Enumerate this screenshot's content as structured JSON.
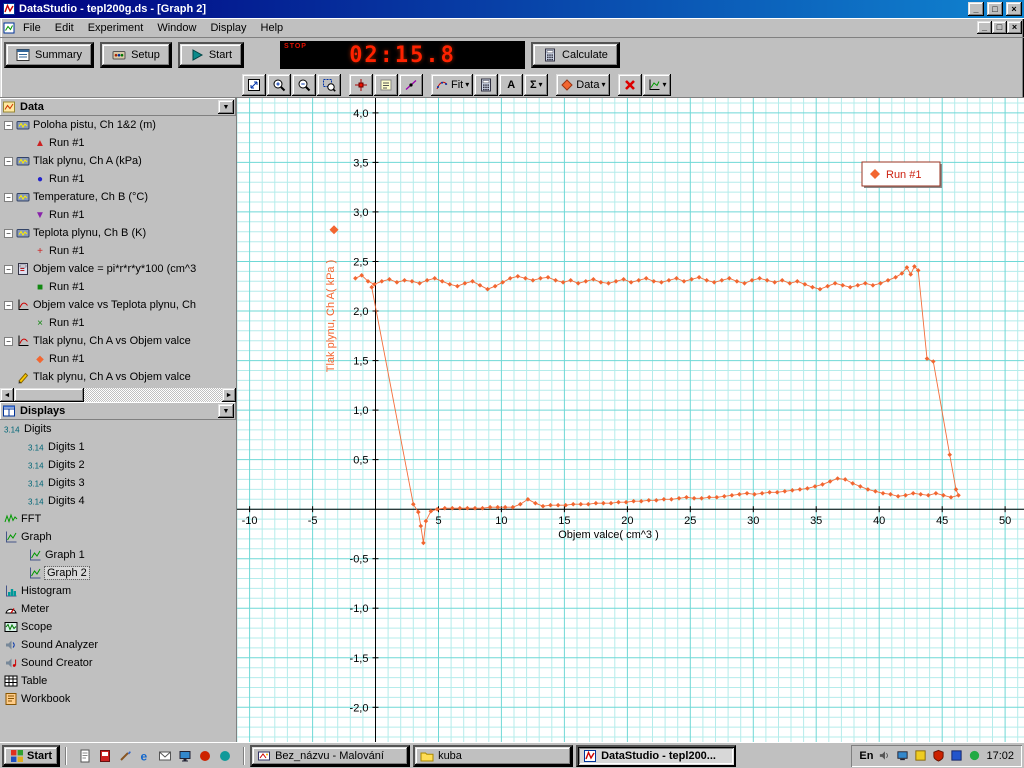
{
  "colors": {
    "grid_minor": "#b5eceb",
    "grid_major": "#6fd8d6",
    "series_orange": "#f26630",
    "legend_text": "#cc2211",
    "chrome": "#c0c0c0"
  },
  "window": {
    "title": "DataStudio - tepl200g.ds - [Graph 2]",
    "menus": [
      "File",
      "Edit",
      "Experiment",
      "Window",
      "Display",
      "Help"
    ]
  },
  "toolbar": {
    "summary_label": "Summary",
    "setup_label": "Setup",
    "start_label": "Start",
    "timer_stop": "STOP",
    "timer_value": "02:15.8",
    "calculate_label": "Calculate"
  },
  "graph_toolbar": {
    "buttons": [
      {
        "name": "scale-to-fit-button",
        "icon": "scale_fit"
      },
      {
        "name": "zoom-in-button",
        "icon": "zoom_in"
      },
      {
        "name": "zoom-out-button",
        "icon": "zoom_out"
      },
      {
        "name": "zoom-select-button",
        "icon": "zoom_sel",
        "gap": true
      },
      {
        "name": "smart-tool-button",
        "icon": "smart"
      },
      {
        "name": "note-tool-button",
        "icon": "note"
      },
      {
        "name": "slope-tool-button",
        "icon": "slope",
        "gap": true
      },
      {
        "name": "fit-menu-button",
        "icon": "fit_line",
        "label": "Fit",
        "dropdown": true
      },
      {
        "name": "calculator-tool-button",
        "icon": "calc"
      },
      {
        "name": "text-tool-button",
        "label": "A",
        "bold": true
      },
      {
        "name": "statistics-menu-button",
        "label": "Σ",
        "bold": true,
        "dropdown": true,
        "gap": true
      },
      {
        "name": "data-menu-button",
        "icon": "data_diamond",
        "label": "Data",
        "dropdown": true,
        "gap": true
      },
      {
        "name": "delete-button",
        "icon": "delete_x"
      },
      {
        "name": "graph-settings-button",
        "icon": "graph_settings",
        "dropdown": true
      }
    ]
  },
  "data_panel": {
    "title": "Data",
    "items": [
      {
        "label": "Poloha pistu, Ch 1&2 (m)",
        "icon": "sensor",
        "expand": true,
        "runs": [
          {
            "label": "Run #1",
            "marker": "triangle-up",
            "color": "#cc2222"
          }
        ]
      },
      {
        "label": "Tlak plynu, Ch A (kPa)",
        "icon": "sensor",
        "expand": true,
        "runs": [
          {
            "label": "Run #1",
            "marker": "circle",
            "color": "#2222cc"
          }
        ]
      },
      {
        "label": "Temperature, Ch B (°C)",
        "icon": "sensor",
        "expand": true,
        "runs": [
          {
            "label": "Run #1",
            "marker": "triangle-down",
            "color": "#8822aa"
          }
        ]
      },
      {
        "label": "Teplota plynu, Ch B (K)",
        "icon": "sensor",
        "expand": true,
        "runs": [
          {
            "label": "Run #1",
            "marker": "plus",
            "color": "#cc2222"
          }
        ]
      },
      {
        "label": "Objem valce = pi*r*r*y*100 (cm^3",
        "icon": "calcdata",
        "expand": true,
        "runs": [
          {
            "label": "Run #1",
            "marker": "square",
            "color": "#118811"
          }
        ]
      },
      {
        "label": "Objem valce vs Teplota plynu, Ch",
        "icon": "xy",
        "expand": true,
        "runs": [
          {
            "label": "Run #1",
            "marker": "x",
            "color": "#118811"
          }
        ]
      },
      {
        "label": "Tlak plynu, Ch A vs Objem valce",
        "icon": "xy",
        "expand": true,
        "runs": [
          {
            "label": "Run #1",
            "marker": "diamond",
            "color": "#f26630"
          }
        ]
      },
      {
        "label": "Tlak plynu, Ch A vs Objem valce",
        "icon": "pen",
        "expand": false,
        "runs": []
      }
    ]
  },
  "displays_panel": {
    "title": "Displays",
    "items": [
      {
        "label": "Digits",
        "icon": "digits",
        "children": [
          "Digits 1",
          "Digits 2",
          "Digits 3",
          "Digits 4"
        ]
      },
      {
        "label": "FFT",
        "icon": "fft",
        "children": []
      },
      {
        "label": "Graph",
        "icon": "graphd",
        "children": [
          "Graph 1",
          "Graph 2"
        ],
        "selected_child": "Graph 2"
      },
      {
        "label": "Histogram",
        "icon": "histogram",
        "children": []
      },
      {
        "label": "Meter",
        "icon": "meter",
        "children": []
      },
      {
        "label": "Scope",
        "icon": "scope",
        "children": []
      },
      {
        "label": "Sound Analyzer",
        "icon": "sound_an",
        "children": []
      },
      {
        "label": "Sound Creator",
        "icon": "sound_cr",
        "children": []
      },
      {
        "label": "Table",
        "icon": "table",
        "children": []
      },
      {
        "label": "Workbook",
        "icon": "workbook",
        "children": []
      }
    ]
  },
  "chart_data": {
    "type": "scatter",
    "title": "",
    "xlabel": "Objem valce( cm^3 )",
    "ylabel": "Tlak plynu, Ch A( kPa )",
    "xlim": [
      -11,
      51.5
    ],
    "ylim": [
      -2.35,
      4.15
    ],
    "x_ticks": [
      -10,
      -5,
      5,
      10,
      15,
      20,
      25,
      30,
      35,
      40,
      45,
      50
    ],
    "y_ticks": [
      4.0,
      3.5,
      3.0,
      2.5,
      2.0,
      1.5,
      1.0,
      0.5,
      -0.5,
      -1.0,
      -1.5,
      -2.0
    ],
    "grid": true,
    "legend": {
      "label": "Run #1",
      "position": "top-right"
    },
    "series": [
      {
        "name": "Run #1",
        "color": "#f26630",
        "marker": "diamond",
        "points": [
          [
            -1.6,
            2.33
          ],
          [
            -1.1,
            2.36
          ],
          [
            -0.6,
            2.3
          ],
          [
            -0.1,
            2.27
          ],
          [
            0.5,
            2.3
          ],
          [
            1.1,
            2.32
          ],
          [
            1.7,
            2.29
          ],
          [
            2.3,
            2.31
          ],
          [
            2.9,
            2.3
          ],
          [
            3.5,
            2.28
          ],
          [
            4.1,
            2.31
          ],
          [
            4.7,
            2.33
          ],
          [
            5.3,
            2.3
          ],
          [
            5.9,
            2.27
          ],
          [
            6.5,
            2.25
          ],
          [
            7.1,
            2.28
          ],
          [
            7.7,
            2.3
          ],
          [
            8.3,
            2.26
          ],
          [
            8.9,
            2.22
          ],
          [
            9.5,
            2.25
          ],
          [
            10.1,
            2.29
          ],
          [
            10.7,
            2.33
          ],
          [
            11.3,
            2.35
          ],
          [
            11.9,
            2.33
          ],
          [
            12.5,
            2.31
          ],
          [
            13.1,
            2.33
          ],
          [
            13.7,
            2.34
          ],
          [
            14.3,
            2.31
          ],
          [
            14.9,
            2.29
          ],
          [
            15.5,
            2.31
          ],
          [
            16.1,
            2.28
          ],
          [
            16.7,
            2.3
          ],
          [
            17.3,
            2.32
          ],
          [
            17.9,
            2.29
          ],
          [
            18.5,
            2.28
          ],
          [
            19.1,
            2.3
          ],
          [
            19.7,
            2.32
          ],
          [
            20.3,
            2.29
          ],
          [
            20.9,
            2.31
          ],
          [
            21.5,
            2.33
          ],
          [
            22.1,
            2.3
          ],
          [
            22.7,
            2.29
          ],
          [
            23.3,
            2.31
          ],
          [
            23.9,
            2.33
          ],
          [
            24.5,
            2.3
          ],
          [
            25.1,
            2.32
          ],
          [
            25.7,
            2.34
          ],
          [
            26.3,
            2.31
          ],
          [
            26.9,
            2.29
          ],
          [
            27.5,
            2.31
          ],
          [
            28.1,
            2.33
          ],
          [
            28.7,
            2.3
          ],
          [
            29.3,
            2.28
          ],
          [
            29.9,
            2.31
          ],
          [
            30.5,
            2.33
          ],
          [
            31.1,
            2.31
          ],
          [
            31.7,
            2.29
          ],
          [
            32.3,
            2.31
          ],
          [
            32.9,
            2.28
          ],
          [
            33.5,
            2.3
          ],
          [
            34.1,
            2.27
          ],
          [
            34.7,
            2.24
          ],
          [
            35.3,
            2.22
          ],
          [
            35.9,
            2.25
          ],
          [
            36.5,
            2.28
          ],
          [
            37.1,
            2.26
          ],
          [
            37.7,
            2.24
          ],
          [
            38.3,
            2.26
          ],
          [
            38.9,
            2.28
          ],
          [
            39.5,
            2.26
          ],
          [
            40.1,
            2.28
          ],
          [
            40.7,
            2.31
          ],
          [
            41.3,
            2.34
          ],
          [
            41.8,
            2.38
          ],
          [
            42.2,
            2.44
          ],
          [
            42.5,
            2.37
          ],
          [
            42.8,
            2.45
          ],
          [
            43.1,
            2.41
          ],
          [
            43.8,
            1.52
          ],
          [
            44.3,
            1.49
          ],
          [
            45.6,
            0.55
          ],
          [
            46.1,
            0.2
          ],
          [
            46.3,
            0.14
          ],
          [
            45.7,
            0.12
          ],
          [
            45.1,
            0.14
          ],
          [
            44.5,
            0.16
          ],
          [
            43.9,
            0.14
          ],
          [
            43.3,
            0.15
          ],
          [
            42.7,
            0.16
          ],
          [
            42.1,
            0.14
          ],
          [
            41.5,
            0.13
          ],
          [
            40.9,
            0.15
          ],
          [
            40.3,
            0.16
          ],
          [
            39.7,
            0.18
          ],
          [
            39.1,
            0.2
          ],
          [
            38.5,
            0.23
          ],
          [
            37.9,
            0.26
          ],
          [
            37.3,
            0.3
          ],
          [
            36.7,
            0.31
          ],
          [
            36.1,
            0.28
          ],
          [
            35.5,
            0.25
          ],
          [
            34.9,
            0.23
          ],
          [
            34.3,
            0.21
          ],
          [
            33.7,
            0.2
          ],
          [
            33.1,
            0.19
          ],
          [
            32.5,
            0.18
          ],
          [
            31.9,
            0.17
          ],
          [
            31.3,
            0.17
          ],
          [
            30.7,
            0.16
          ],
          [
            30.1,
            0.15
          ],
          [
            29.5,
            0.16
          ],
          [
            28.9,
            0.15
          ],
          [
            28.3,
            0.14
          ],
          [
            27.7,
            0.13
          ],
          [
            27.1,
            0.12
          ],
          [
            26.5,
            0.12
          ],
          [
            25.9,
            0.11
          ],
          [
            25.3,
            0.11
          ],
          [
            24.7,
            0.12
          ],
          [
            24.1,
            0.11
          ],
          [
            23.5,
            0.1
          ],
          [
            22.9,
            0.1
          ],
          [
            22.3,
            0.09
          ],
          [
            21.7,
            0.09
          ],
          [
            21.1,
            0.08
          ],
          [
            20.5,
            0.08
          ],
          [
            19.9,
            0.07
          ],
          [
            19.3,
            0.07
          ],
          [
            18.7,
            0.06
          ],
          [
            18.1,
            0.06
          ],
          [
            17.5,
            0.06
          ],
          [
            16.9,
            0.05
          ],
          [
            16.3,
            0.05
          ],
          [
            15.7,
            0.05
          ],
          [
            15.1,
            0.04
          ],
          [
            14.5,
            0.04
          ],
          [
            13.9,
            0.04
          ],
          [
            13.3,
            0.03
          ],
          [
            12.7,
            0.06
          ],
          [
            12.1,
            0.1
          ],
          [
            11.5,
            0.05
          ],
          [
            10.9,
            0.02
          ],
          [
            10.3,
            0.02
          ],
          [
            9.7,
            0.02
          ],
          [
            9.1,
            0.02
          ],
          [
            8.5,
            0.01
          ],
          [
            7.9,
            0.01
          ],
          [
            7.3,
            0.01
          ],
          [
            6.7,
            0.01
          ],
          [
            6.1,
            0.01
          ],
          [
            5.5,
            0.01
          ],
          [
            4.9,
            0.0
          ],
          [
            4.4,
            -0.02
          ],
          [
            4.0,
            -0.12
          ],
          [
            3.8,
            -0.34
          ],
          [
            3.6,
            -0.17
          ],
          [
            3.4,
            -0.03
          ],
          [
            3.0,
            0.05
          ],
          [
            -0.3,
            2.24
          ]
        ]
      }
    ]
  },
  "taskbar": {
    "start_label": "Start",
    "quick_launch": [
      "page",
      "notes",
      "brush",
      "ie",
      "mail",
      "desktop",
      "app_red",
      "app_teal"
    ],
    "tasks": [
      {
        "label": "Bez_názvu - Malování",
        "icon": "paint",
        "active": false
      },
      {
        "label": "kuba",
        "icon": "folder",
        "active": false
      },
      {
        "label": "DataStudio - tepl200...",
        "icon": "app",
        "active": true
      }
    ],
    "tray": {
      "lang": "En",
      "icons": [
        "volume",
        "display_tray",
        "app_yellow",
        "shield_red",
        "app_blue",
        "app_green"
      ],
      "clock": "17:02"
    }
  }
}
